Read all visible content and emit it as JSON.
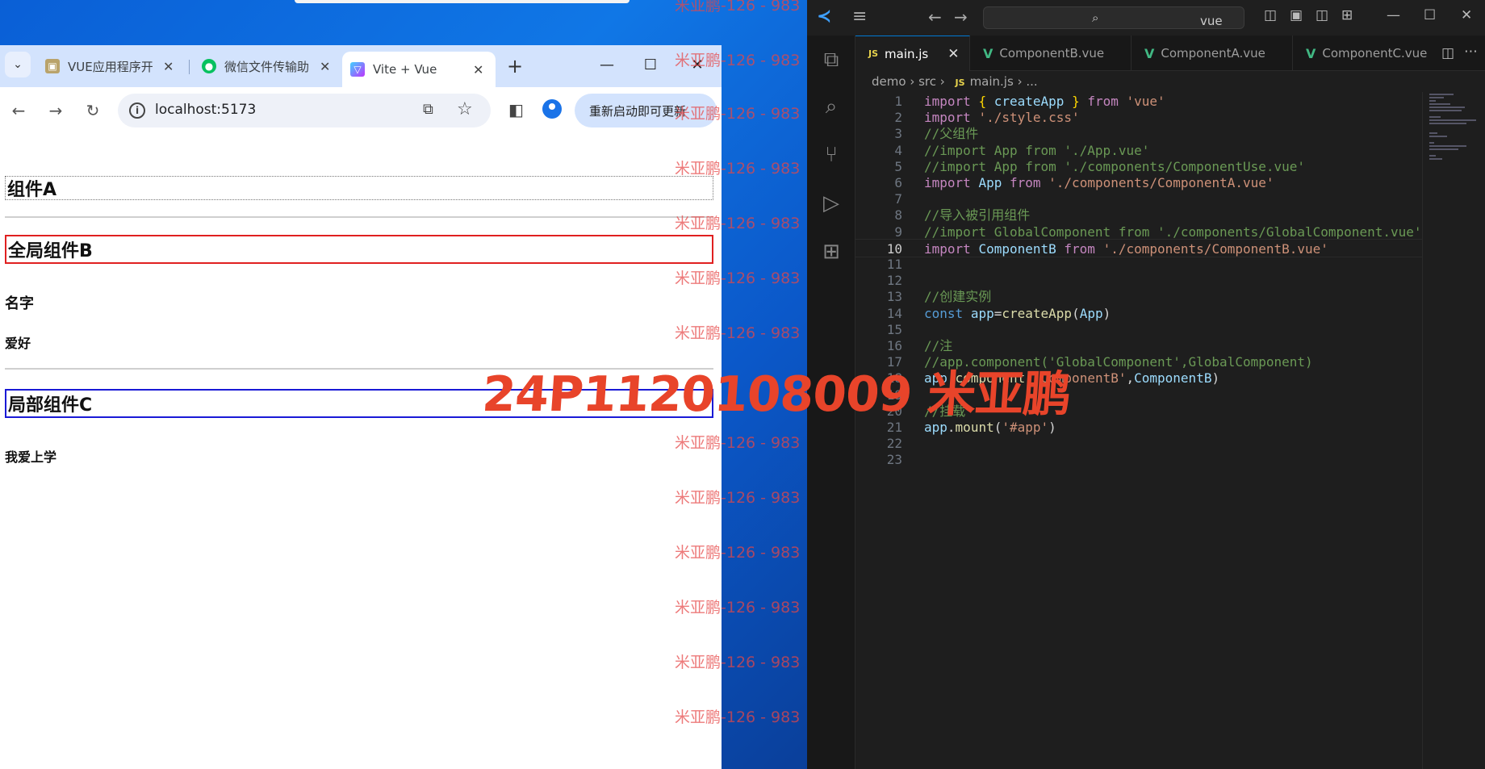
{
  "browser": {
    "tabs": [
      {
        "title": "VUE应用程序开",
        "icon": "image-favicon-icon"
      },
      {
        "title": "微信文件传输助",
        "icon": "wechat-icon"
      },
      {
        "title": "Vite + Vue",
        "icon": "vite-icon"
      }
    ],
    "url": "localhost:5173",
    "update_label": "重新启动即可更新",
    "page": {
      "compA_title": "组件A",
      "compB_title": "全局组件B",
      "name_label": "名字",
      "hobby_label": "爱好",
      "compC_title": "局部组件C",
      "compC_text": "我爱上学"
    }
  },
  "vscode": {
    "search": "vue",
    "tabs": [
      "main.js",
      "ComponentB.vue",
      "ComponentA.vue",
      "ComponentC.vue"
    ],
    "breadcrumb": {
      "p1": "demo",
      "p2": "src",
      "p3": "main.js",
      "p4": "..."
    },
    "current_line": 10,
    "lines": [
      "import { createApp } from 'vue'",
      "import './style.css'",
      "//父组件",
      "//import App from './App.vue'",
      "//import App from './components/ComponentUse.vue'",
      "import App from './components/ComponentA.vue'",
      "",
      "//导入被引用组件",
      "//import GlobalComponent from './components/GlobalComponent.vue'",
      "import ComponentB from './components/ComponentB.vue'",
      "",
      "",
      "//创建实例",
      "const app=createApp(App)",
      "",
      "//注",
      "//app.component('GlobalComponent',GlobalComponent)",
      "app.component('ComponentB',ComponentB)",
      "",
      "//挂载",
      "app.mount('#app')",
      "",
      ""
    ]
  },
  "watermark": {
    "repeat_text": "米亚鹏-126 - 983",
    "big_text": "24P1120108009 米亚鹏"
  },
  "colors": {
    "accent_red": "#e02020",
    "accent_blue": "#1a1ad6",
    "vscode_accent": "#0078d4"
  }
}
